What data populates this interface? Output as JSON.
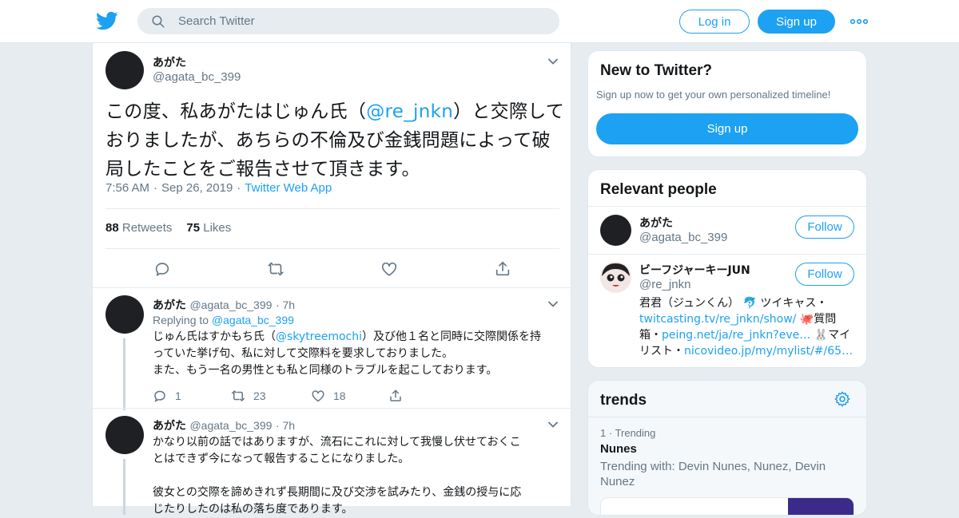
{
  "header": {
    "search_placeholder": "Search Twitter",
    "login_label": "Log in",
    "signup_label": "Sign up",
    "brand_color": "#1da1f2"
  },
  "main_tweet": {
    "name": "あがた",
    "handle": "@agata_bc_399",
    "text_before": "この度、私あがたはじゅん氏（",
    "mention": "@re_jnkn",
    "text_after": "）と交際しておりましたが、あちらの不倫及び金銭問題によって破局したことをご報告させて頂きます。",
    "time": "7:56 AM",
    "date": "Sep 26, 2019",
    "source": "Twitter Web App",
    "retweets_count": "88",
    "retweets_label": "Retweets",
    "likes_count": "75",
    "likes_label": "Likes"
  },
  "replies": [
    {
      "name": "あがた",
      "handle": "@agata_bc_399",
      "time": "7h",
      "replying_label": "Replying to",
      "replying_to": "@agata_bc_399",
      "line1_before": "じゅん氏はすかもち氏（",
      "line1_mention": "@skytreemochi",
      "line1_after": "）及び他１名と同時に交際関係を持",
      "line2": "っていた挙げ句、私に対して交際料を要求しておりました。",
      "line3": "また、もう一名の男性とも私と同様のトラブルを起こしております。",
      "reply_count": "1",
      "retweet_count": "23",
      "like_count": "18"
    },
    {
      "name": "あがた",
      "handle": "@agata_bc_399",
      "time": "7h",
      "line1": "かなり以前の話ではありますが、流石にこれに対して我慢し伏せておくこ",
      "line2": "とはできず今になって報告することになりました。",
      "line3": "彼女との交際を諦めきれず長期間に及び交渉を試みたり、金銭の授与に応",
      "line4": "じたりしたのは私の落ち度であります。"
    }
  ],
  "new_to_twitter": {
    "title": "New to Twitter?",
    "subtitle": "Sign up now to get your own personalized timeline!",
    "signup_label": "Sign up"
  },
  "relevant_people": {
    "title": "Relevant people",
    "people": [
      {
        "name": "あがた",
        "handle": "@agata_bc_399",
        "follow_label": "Follow"
      },
      {
        "name": "ビーフジャーキーJUN",
        "handle": "@re_jnkn",
        "follow_label": "Follow",
        "bio_1": "君君（ジュンくん） ",
        "bio_icon_1": "🐬",
        "bio_2": " ツイキャス・",
        "bio_link_1": "twitcasting.tv/re_jnkn/show/",
        "bio_icon_2": "🐙",
        "bio_3": "質問箱・",
        "bio_link_2": "peing.net/ja/re_jnkn?eve…",
        "bio_icon_3": "🐰",
        "bio_4": "マイリスト・",
        "bio_link_3": "nicovideo.jp/my/mylist/#/65…"
      }
    ]
  },
  "trends": {
    "title": "trends",
    "items": [
      {
        "rank": "1",
        "rank_label": "Trending",
        "name": "Nunes",
        "with": "Trending with: Devin Nunes, Nunez, Devin Nunez"
      }
    ]
  }
}
